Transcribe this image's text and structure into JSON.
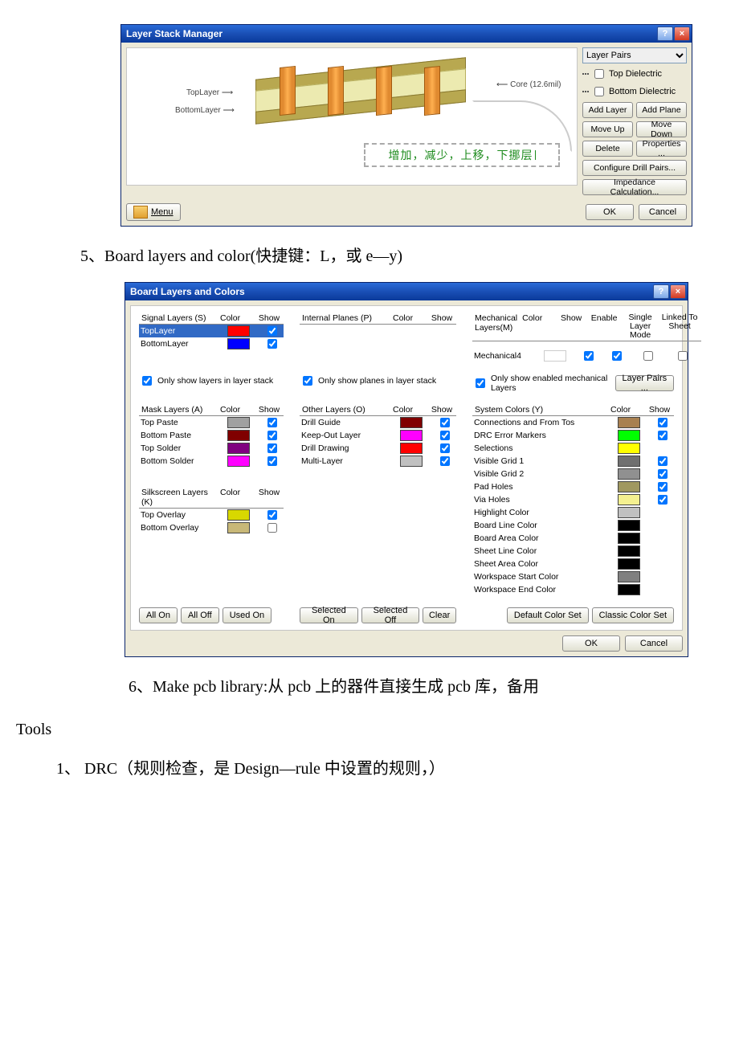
{
  "dialog1": {
    "title": "Layer Stack Manager",
    "labels": {
      "topLayer": "TopLayer",
      "bottomLayer": "BottomLayer",
      "core": "Core (12.6mil)"
    },
    "side": {
      "layerPairsLabel": "Layer Pairs",
      "topDielectric": "Top Dielectric",
      "bottomDielectric": "Bottom Dielectric",
      "addLayer": "Add Layer",
      "addPlane": "Add Plane",
      "moveUp": "Move Up",
      "moveDown": "Move Down",
      "delete": "Delete",
      "properties": "Properties ...",
      "configureDrillPairs": "Configure Drill Pairs...",
      "impedanceCalc": "Impedance Calculation..."
    },
    "annotation": "增加，减少，上移，下挪层",
    "menu": "Menu",
    "ok": "OK",
    "cancel": "Cancel"
  },
  "text1": "5、Board layers and color(快捷键：L，或 e—y)",
  "dialog2": {
    "title": "Board Layers and Colors",
    "signal": {
      "header": "Signal Layers (S)",
      "items": [
        {
          "name": "TopLayer",
          "color": "#ff0000",
          "checked": true,
          "selected": true
        },
        {
          "name": "BottomLayer",
          "color": "#0000ff",
          "checked": true
        }
      ]
    },
    "internal": {
      "header": "Internal Planes (P)"
    },
    "mechanical": {
      "header": "Mechanical Layers(M)",
      "items": [
        {
          "name": "Mechanical4",
          "color": "",
          "show": true,
          "enable": true
        }
      ]
    },
    "layerPairsBtn": "Layer Pairs ...",
    "onlyShowStack": "Only show layers in layer stack",
    "onlyShowPlanes": "Only show planes in layer stack",
    "onlyShowMech": "Only show enabled mechanical Layers",
    "mask": {
      "header": "Mask Layers (A)",
      "items": [
        {
          "name": "Top Paste",
          "color": "#a0a0a0",
          "checked": true
        },
        {
          "name": "Bottom Paste",
          "color": "#800000",
          "checked": true
        },
        {
          "name": "Top Solder",
          "color": "#800080",
          "checked": true
        },
        {
          "name": "Bottom Solder",
          "color": "#ff00ff",
          "checked": true
        }
      ]
    },
    "silk": {
      "header": "Silkscreen Layers (K)",
      "items": [
        {
          "name": "Top Overlay",
          "color": "#d8d800",
          "checked": true
        },
        {
          "name": "Bottom Overlay",
          "color": "#c8b878",
          "checked": false
        }
      ]
    },
    "other": {
      "header": "Other Layers (O)",
      "items": [
        {
          "name": "Drill Guide",
          "color": "#800000",
          "checked": true
        },
        {
          "name": "Keep-Out Layer",
          "color": "#ff00ff",
          "checked": true
        },
        {
          "name": "Drill Drawing",
          "color": "#ff0000",
          "checked": true
        },
        {
          "name": "Multi-Layer",
          "color": "#c0c0c0",
          "checked": true
        }
      ]
    },
    "system": {
      "header": "System Colors (Y)",
      "items": [
        {
          "name": "Connections and From Tos",
          "color": "#a88050",
          "checked": true
        },
        {
          "name": "DRC Error Markers",
          "color": "#00ff00",
          "checked": true
        },
        {
          "name": "Selections",
          "color": "#ffff00",
          "checked": null
        },
        {
          "name": "Visible Grid 1",
          "color": "#707070",
          "checked": true
        },
        {
          "name": "Visible Grid 2",
          "color": "#909090",
          "checked": true
        },
        {
          "name": "Pad Holes",
          "color": "#a09860",
          "checked": true
        },
        {
          "name": "Via Holes",
          "color": "#f4f090",
          "checked": true
        },
        {
          "name": "Highlight Color",
          "color": "#c0c0c0",
          "checked": null
        },
        {
          "name": "Board Line Color",
          "color": "#000000",
          "checked": null
        },
        {
          "name": "Board Area Color",
          "color": "#000000",
          "checked": null
        },
        {
          "name": "Sheet Line Color",
          "color": "#000000",
          "checked": null
        },
        {
          "name": "Sheet Area Color",
          "color": "#000000",
          "checked": null
        },
        {
          "name": "Workspace Start Color",
          "color": "#808080",
          "checked": null
        },
        {
          "name": "Workspace End Color",
          "color": "#000000",
          "checked": null
        }
      ]
    },
    "headers": {
      "color": "Color",
      "show": "Show",
      "enable": "Enable",
      "singleLayer": "Single Layer Mode",
      "linkedTo": "Linked To Sheet"
    },
    "buttons": {
      "allOn": "All On",
      "allOff": "All Off",
      "usedOn": "Used On",
      "selectedOn": "Selected On",
      "selectedOff": "Selected Off",
      "clear": "Clear",
      "defaultColorSet": "Default Color Set",
      "classicColorSet": "Classic Color Set",
      "ok": "OK",
      "cancel": "Cancel"
    }
  },
  "text2": "6、Make pcb library:从 pcb 上的器件直接生成 pcb 库，备用",
  "text3": "Tools",
  "text4": "1、 DRC（规则检查，是 Design—rule 中设置的规则，）"
}
